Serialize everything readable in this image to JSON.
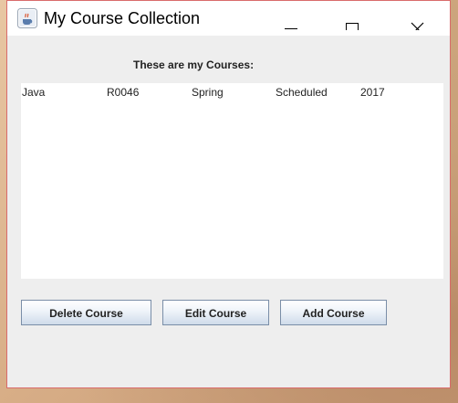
{
  "window": {
    "title": "My Course Collection",
    "app_icon": "java-cup-icon",
    "controls": [
      "minimize-icon",
      "maximize-icon",
      "close-icon"
    ]
  },
  "main": {
    "heading": "These are my Courses:",
    "courses": [
      [
        "Java",
        "R0046",
        "Spring",
        "Scheduled",
        "2017"
      ]
    ]
  },
  "buttons": {
    "delete_label": "Delete Course",
    "edit_label": "Edit Course",
    "add_label": "Add Course"
  }
}
